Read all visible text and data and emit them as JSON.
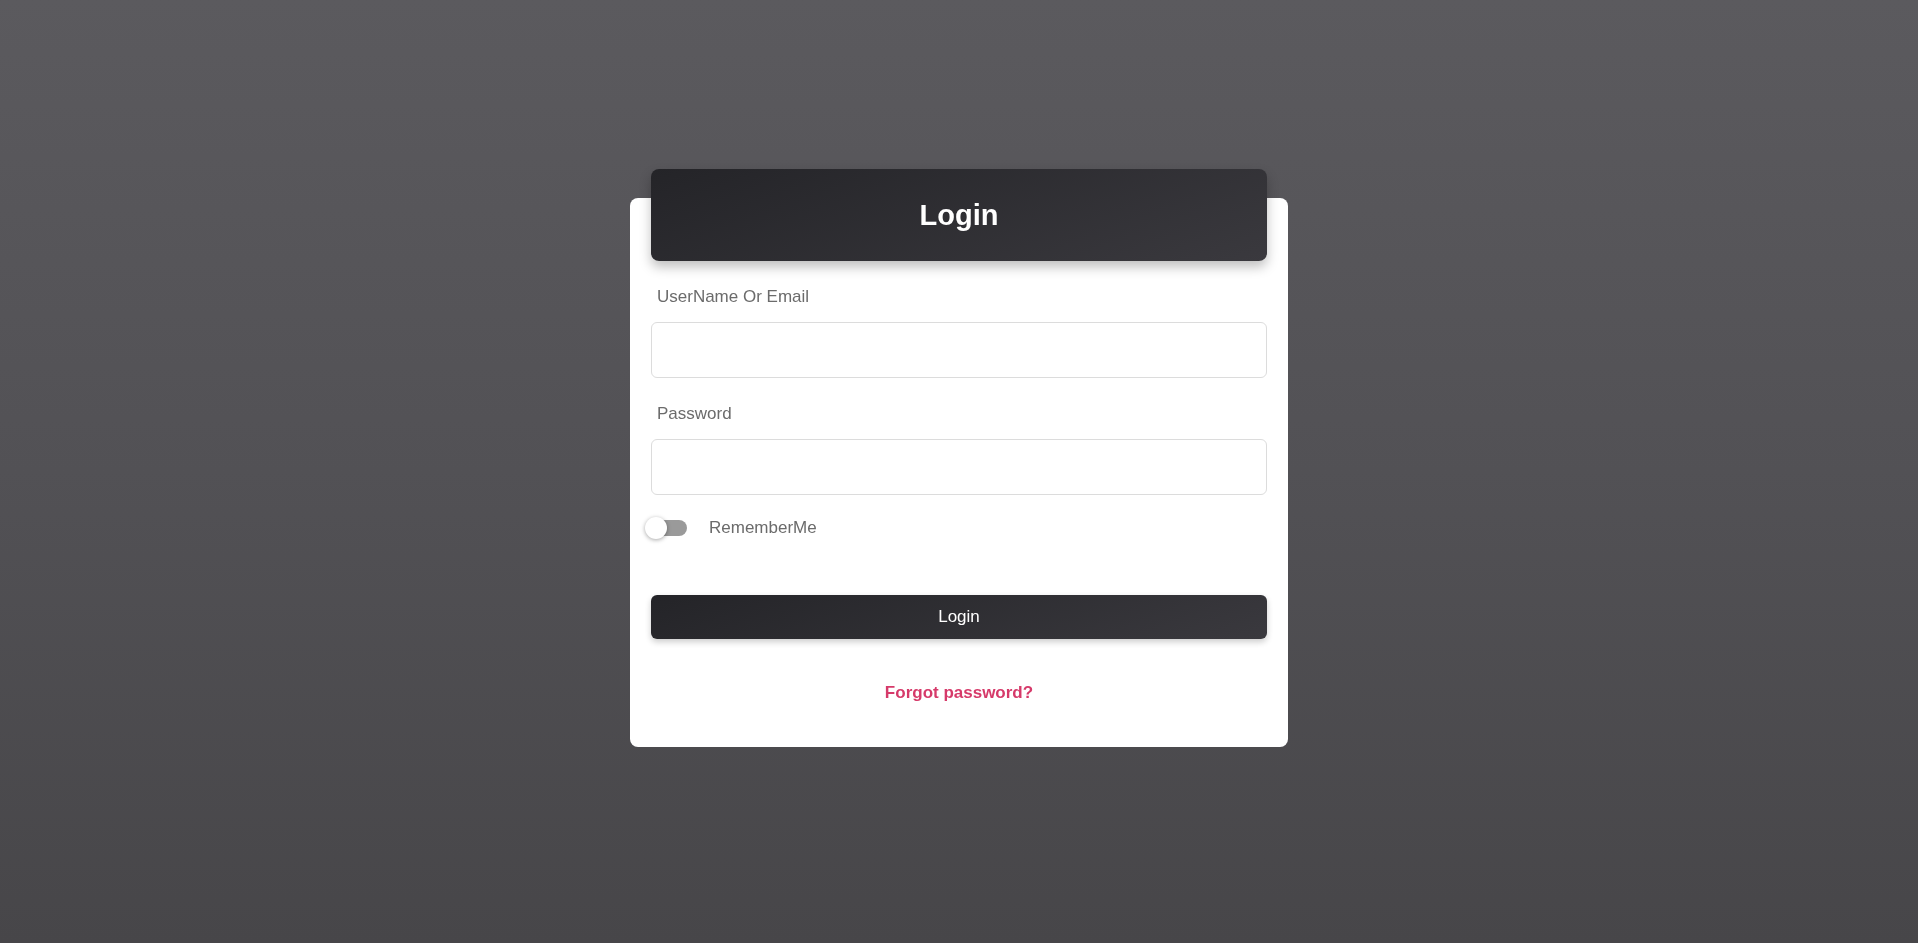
{
  "card": {
    "title": "Login",
    "fields": [
      {
        "label": "UserName Or Email"
      },
      {
        "label": "Password"
      }
    ],
    "remember": {
      "label": "RememberMe",
      "on": false
    },
    "submit": {
      "label": "Login"
    },
    "forgot_link": {
      "label": "Forgot password?"
    }
  }
}
